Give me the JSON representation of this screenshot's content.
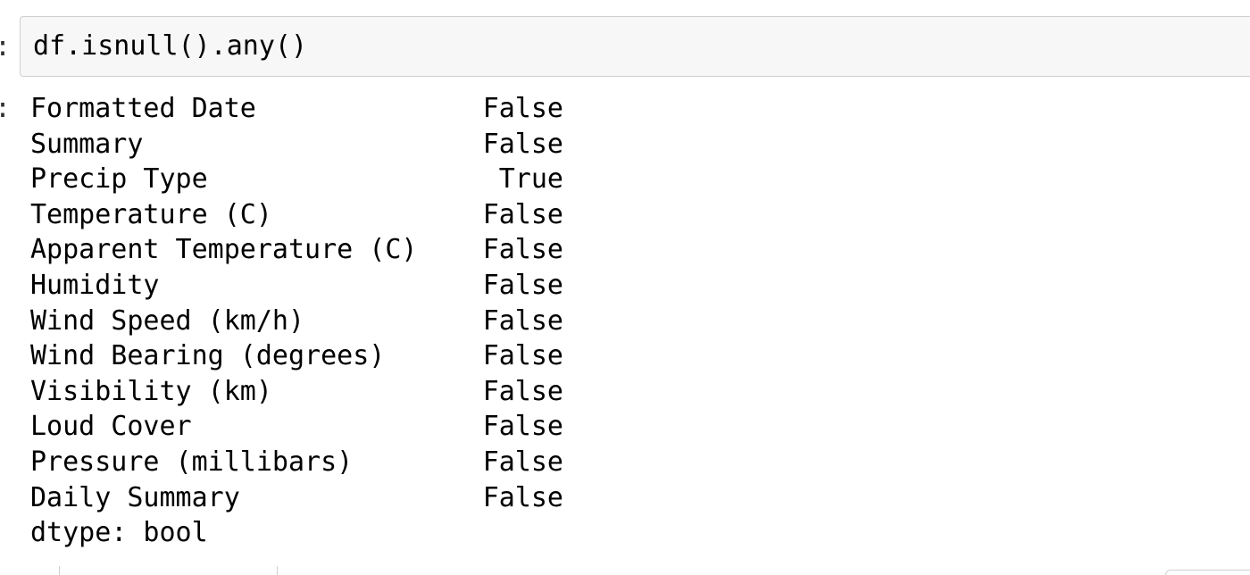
{
  "input": {
    "prompt_suffix": ":",
    "code": "df.isnull().any()"
  },
  "output": {
    "prompt_suffix": ":",
    "rows": [
      {
        "name": "Formatted Date",
        "value": "False"
      },
      {
        "name": "Summary",
        "value": "False"
      },
      {
        "name": "Precip Type",
        "value": "True"
      },
      {
        "name": "Temperature (C)",
        "value": "False"
      },
      {
        "name": "Apparent Temperature (C)",
        "value": "False"
      },
      {
        "name": "Humidity",
        "value": "False"
      },
      {
        "name": "Wind Speed (km/h)",
        "value": "False"
      },
      {
        "name": "Wind Bearing (degrees)",
        "value": "False"
      },
      {
        "name": "Visibility (km)",
        "value": "False"
      },
      {
        "name": "Loud Cover",
        "value": "False"
      },
      {
        "name": "Pressure (millibars)",
        "value": "False"
      },
      {
        "name": "Daily Summary",
        "value": "False"
      }
    ],
    "dtype": "dtype: bool"
  }
}
